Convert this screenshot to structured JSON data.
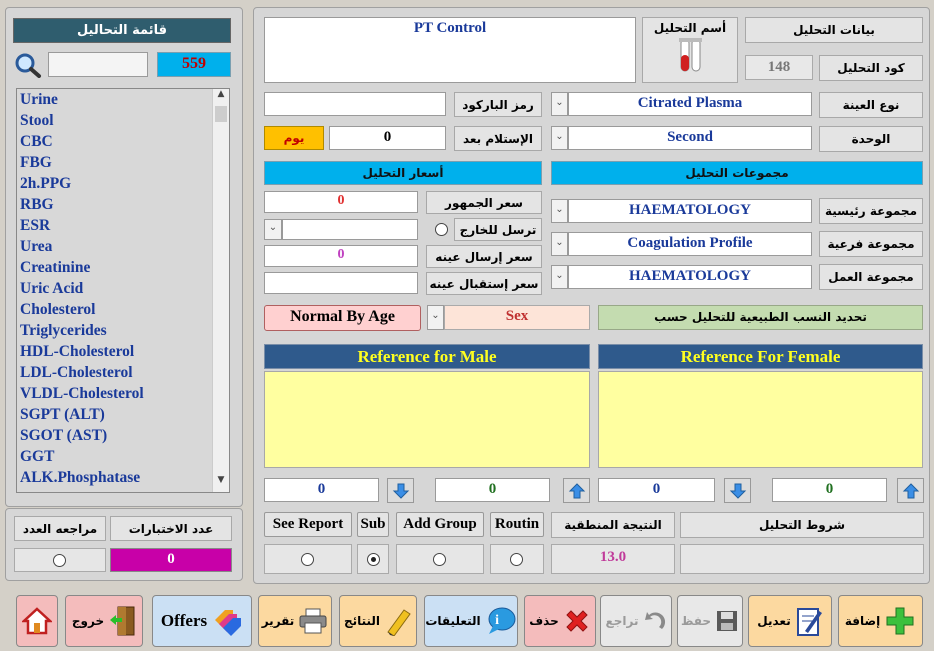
{
  "sidebar": {
    "title": "قائمة التحاليل",
    "count": "559",
    "search_value": "",
    "items": [
      "Urine",
      "Stool",
      "CBC",
      "FBG",
      "2h.PPG",
      "RBG",
      "ESR",
      "Urea",
      "Creatinine",
      "Uric Acid",
      "Cholesterol",
      "Triglycerides",
      "HDL-Cholesterol",
      "LDL-Cholesterol",
      "VLDL-Cholesterol",
      "SGPT (ALT)",
      "SGOT (AST)",
      "GGT",
      "ALK.Phosphatase"
    ],
    "tests_count_label": "عدد الاختبارات",
    "review_count_label": "مراجعه العدد",
    "tests_count_value": "0"
  },
  "test_info": {
    "section_label": "بيانات التحليل",
    "name_label": "أسم التحليل",
    "name_value": "PT Control",
    "code_label": "كود التحليل",
    "code_value": "148",
    "sample_type_label": "نوع العينة",
    "sample_type_value": "Citrated Plasma",
    "unit_label": "الوحدة",
    "unit_value": "Second",
    "barcode_label": "رمز الباركود",
    "barcode_value": "",
    "receive_after_label": "الإستلام بعد",
    "receive_after_value": "0",
    "day_label": "يوم"
  },
  "groups": {
    "title": "مجموعات التحليل",
    "main_label": "مجموعة رئيسية",
    "main_value": "HAEMATOLOGY",
    "sub_label": "مجموعة فرعية",
    "sub_value": "Coagulation Profile",
    "work_label": "مجموعة العمل",
    "work_value": "HAEMATOLOGY"
  },
  "prices": {
    "title": "أسعار التحليل",
    "public_label": "سعر الجمهور",
    "public_value": "0",
    "send_out_label": "ترسل للخارج",
    "send_out_value": "",
    "send_sample_label": "سعر إرسال عينه",
    "send_sample_value": "0",
    "receive_sample_label": "سعر إستقبال عينه",
    "receive_sample_value": ""
  },
  "normal": {
    "determine_label": "تحديد النسب الطبيعية للتحليل حسب",
    "by_label": "Sex",
    "normal_by_age_button": "Normal By Age"
  },
  "reference": {
    "male_title": "Reference for Male",
    "female_title": "Reference For Female",
    "male_left": "0",
    "male_right": "0",
    "female_left": "0",
    "female_right": "0"
  },
  "options": {
    "see_report": "See Report",
    "sub": "Sub",
    "add_group": "Add Group",
    "routin": "Routin",
    "logical_result_label": "النتيجة المنطقية",
    "logical_result_value": "13.0",
    "conditions_label": "شروط التحليل"
  },
  "toolbar": {
    "add": "إضافة",
    "edit": "تعديل",
    "save": "حفظ",
    "undo": "تراجع",
    "delete": "حذف",
    "comments": "التعليقات",
    "results": "النتائج",
    "report": "تقرير",
    "offers": "Offers",
    "exit": "خروج"
  },
  "colors": {
    "accent_blue": "#00b0ec",
    "count_magenta": "#c800a8",
    "day_orange": "#ffc000",
    "ref_header": "#2f5a8c",
    "ref_body": "#ffffa0"
  }
}
